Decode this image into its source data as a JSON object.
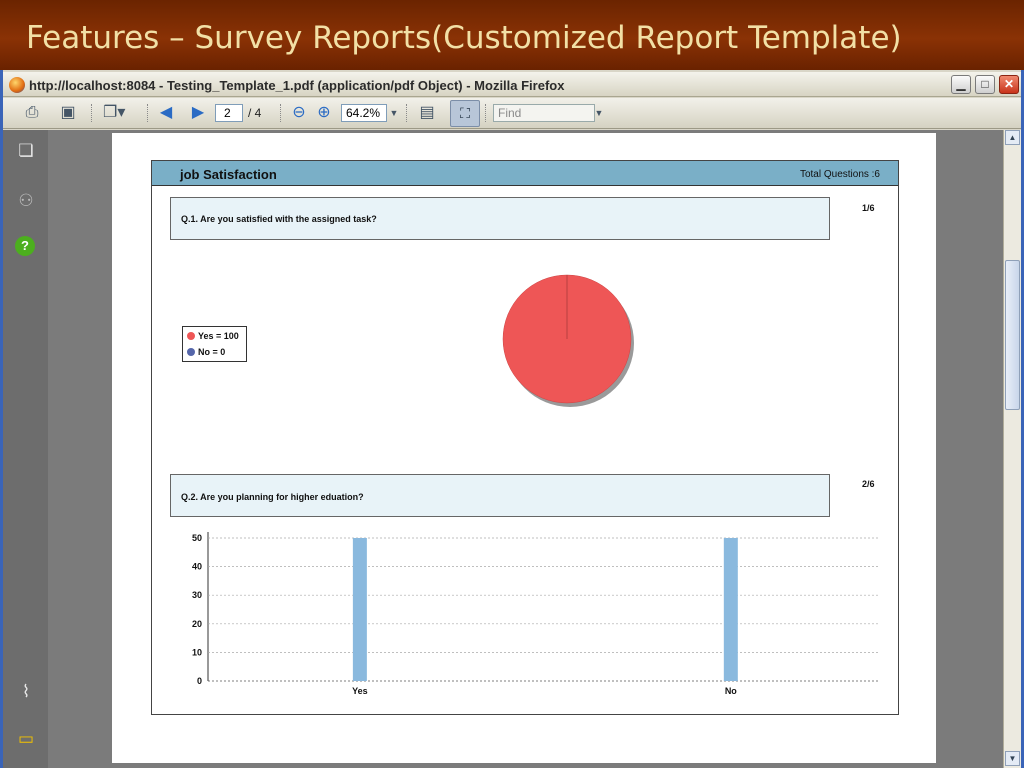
{
  "slide": {
    "title": "Features – Survey Reports(Customized Report Template)"
  },
  "window": {
    "title": "http://localhost:8084 - Testing_Template_1.pdf (application/pdf Object) - Mozilla Firefox",
    "minimize_icon": "minimize-icon",
    "maximize_icon": "maximize-icon",
    "close_icon": "close-icon"
  },
  "toolbar": {
    "current_page": "2",
    "total_pages": "/ 4",
    "zoom": "64.2%",
    "find_placeholder": "Find",
    "icons": [
      "print-icon",
      "save-icon",
      "pages-icon",
      "prev-page-icon",
      "next-page-icon",
      "zoom-out-icon",
      "zoom-in-icon",
      "fit-page-icon",
      "fit-width-icon"
    ]
  },
  "left_pane": {
    "icons": [
      "pages-panel-icon",
      "binoculars-icon",
      "help-icon",
      "attachment-icon",
      "comments-icon"
    ]
  },
  "report": {
    "title": "job Satisfaction",
    "total_questions": "Total Questions :6",
    "questions": [
      {
        "text": "Q.1. Are you satisfied with the assigned task?",
        "number": "1/6"
      },
      {
        "text": "Q.2. Are you planning for higher eduation?",
        "number": "2/6"
      }
    ]
  },
  "chart_data": [
    {
      "type": "pie",
      "categories": [
        "Yes",
        "No"
      ],
      "values": [
        100,
        0
      ],
      "legend": [
        "Yes = 100",
        "No = 0"
      ],
      "colors": [
        "#ee5656",
        "#5566aa"
      ],
      "legend_position": "left"
    },
    {
      "type": "bar",
      "categories": [
        "Yes",
        "No"
      ],
      "values": [
        50,
        50
      ],
      "yticks": [
        0,
        10,
        20,
        30,
        40,
        50
      ],
      "ylim": [
        0,
        50
      ],
      "grid": true,
      "bar_color": "#8ab9de"
    }
  ]
}
